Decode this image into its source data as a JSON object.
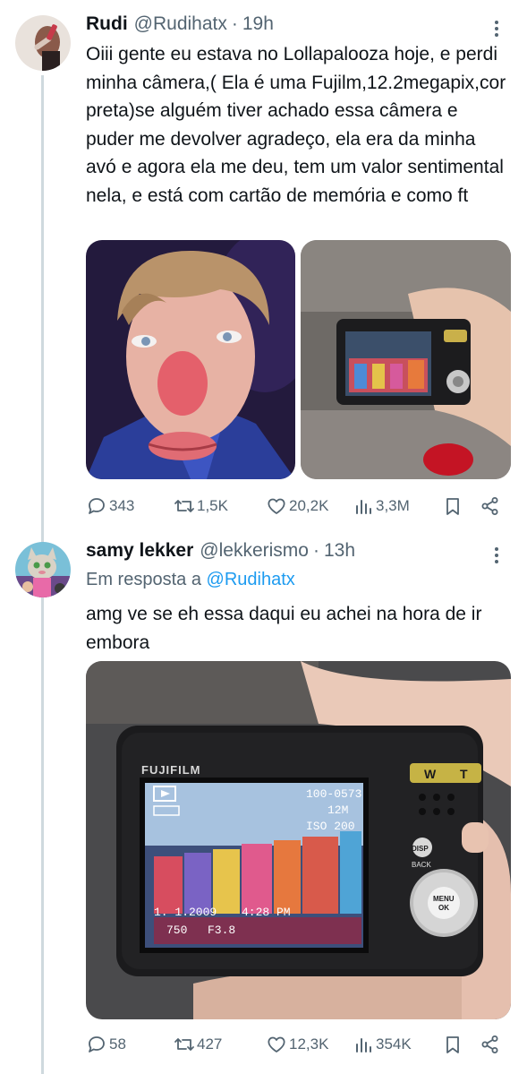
{
  "tweets": [
    {
      "display_name": "Rudi",
      "handle": "@Rudihatx",
      "separator": "·",
      "time": "19h",
      "text": "Oiii gente eu estava no Lollapalooza hoje, e perdi minha câmera,( Ela é uma Fujilm,12.2megapix,cor preta)se alguém tiver achado essa câmera e puder me devolver agradeço, ela era da minha avó e agora ela me deu, tem um valor sentimental nela, e está com cartão de memória e como ft",
      "stats": {
        "replies": "343",
        "retweets": "1,5K",
        "likes": "20,2K",
        "views": "3,3M"
      }
    },
    {
      "display_name": "samy lekker",
      "handle": "@lekkerismo",
      "separator": "·",
      "time": "13h",
      "reply_prefix": "Em resposta a",
      "reply_mention": "@Rudihatx",
      "text": "amg ve se eh essa daqui eu achei na hora de ir embora",
      "stats": {
        "replies": "58",
        "retweets": "427",
        "likes": "12,3K",
        "views": "354K"
      }
    }
  ],
  "camera": {
    "brand": "FUJIFILM",
    "screen_counter": "100-0573",
    "screen_size": "12M",
    "screen_iso": "ISO 200",
    "screen_date": "1. 1.2009",
    "screen_time": "4:28 PM",
    "screen_shutter": "750",
    "screen_aperture": "F3.8",
    "btn_disp": "DISP",
    "btn_back": "BACK",
    "btn_menu": "MENU",
    "btn_ok": "OK",
    "zoom_w": "W",
    "zoom_t": "T"
  },
  "icons": {
    "reply": "reply-icon",
    "retweet": "retweet-icon",
    "like": "heart-icon",
    "views": "views-icon",
    "bookmark": "bookmark-icon",
    "share": "share-icon",
    "more": "more-icon"
  },
  "colors": {
    "text": "#0f1419",
    "secondary": "#536471",
    "link": "#1d9bf0",
    "thread_line": "#cfd9de"
  }
}
